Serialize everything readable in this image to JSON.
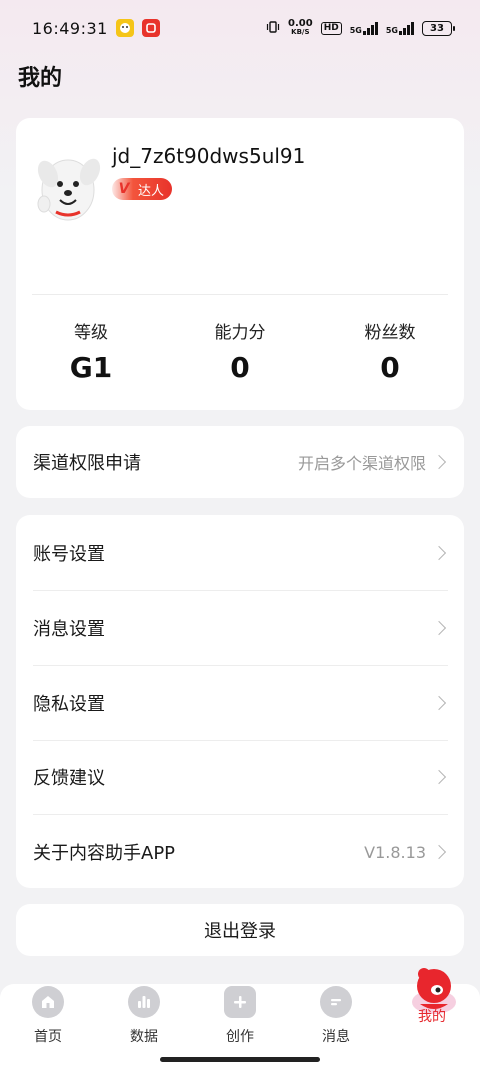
{
  "status_bar": {
    "time": "16:49:31",
    "net_speed_value": "0.00",
    "net_speed_unit": "KB/S",
    "hd_label": "HD",
    "signal1": "5G",
    "signal2": "5G",
    "battery": "33"
  },
  "page": {
    "title": "我的"
  },
  "profile": {
    "username": "jd_7z6t90dws5ul91",
    "badge_v": "V",
    "badge_label": "达人"
  },
  "stats": [
    {
      "label": "等级",
      "value": "G1"
    },
    {
      "label": "能力分",
      "value": "0"
    },
    {
      "label": "粉丝数",
      "value": "0"
    }
  ],
  "channel": {
    "label": "渠道权限申请",
    "hint": "开启多个渠道权限"
  },
  "settings": [
    {
      "label": "账号设置",
      "hint": ""
    },
    {
      "label": "消息设置",
      "hint": ""
    },
    {
      "label": "隐私设置",
      "hint": ""
    },
    {
      "label": "反馈建议",
      "hint": ""
    },
    {
      "label": "关于内容助手APP",
      "hint": "V1.8.13"
    }
  ],
  "logout_label": "退出登录",
  "tabs": [
    {
      "label": "首页",
      "icon": "home-icon"
    },
    {
      "label": "数据",
      "icon": "data-icon"
    },
    {
      "label": "创作",
      "icon": "create-icon"
    },
    {
      "label": "消息",
      "icon": "message-icon"
    },
    {
      "label": "我的",
      "icon": "mascot-icon",
      "active": true
    }
  ],
  "colors": {
    "accent": "#e6282e",
    "background": "#f2f2f4",
    "tab_icon": "#cfcfd3"
  }
}
